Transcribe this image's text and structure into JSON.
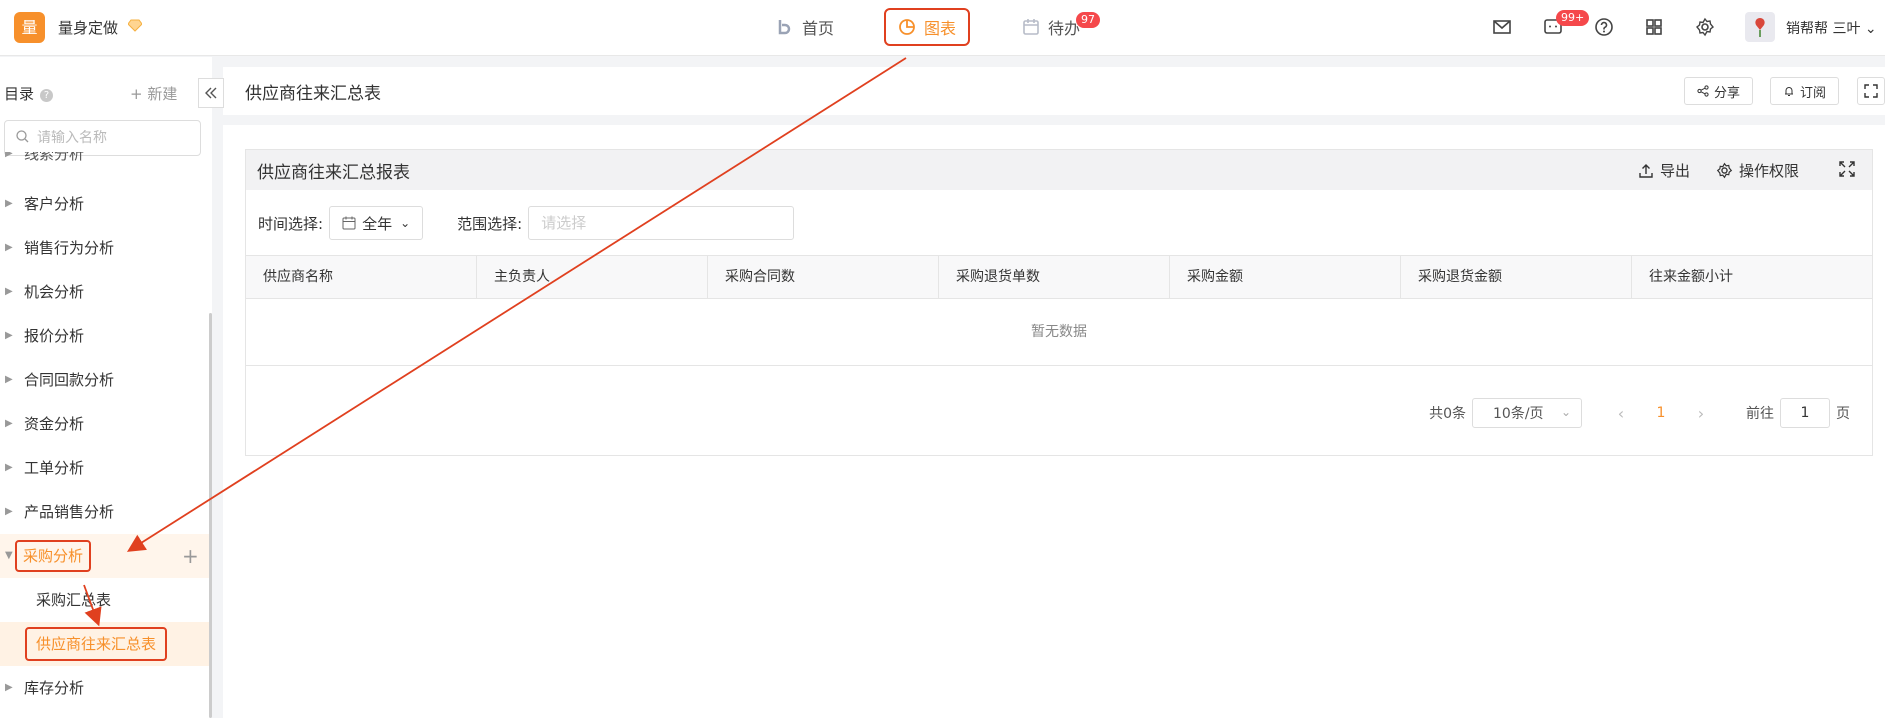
{
  "app": {
    "logo_char": "量",
    "name": "量身定做"
  },
  "nav": [
    {
      "label": "首页"
    },
    {
      "label": "图表"
    },
    {
      "label": "待办"
    }
  ],
  "badges": {
    "todo": "97",
    "messages": "99+"
  },
  "header_icons": [
    "mail-icon",
    "message-icon",
    "help-icon",
    "apps-grid-icon",
    "settings-icon"
  ],
  "user": {
    "name": "销帮帮 三叶"
  },
  "sidebar": {
    "title": "目录",
    "help": "?",
    "new_label": "+ 新建",
    "search_placeholder": "请输入名称",
    "items": [
      {
        "label": "线索分析"
      },
      {
        "label": "客户分析"
      },
      {
        "label": "销售行为分析"
      },
      {
        "label": "机会分析"
      },
      {
        "label": "报价分析"
      },
      {
        "label": "合同回款分析"
      },
      {
        "label": "资金分析"
      },
      {
        "label": "工单分析"
      },
      {
        "label": "产品销售分析"
      },
      {
        "label": "采购分析"
      },
      {
        "label": "库存分析"
      }
    ],
    "sub_items": [
      {
        "label": "采购汇总表"
      },
      {
        "label": "供应商往来汇总表"
      }
    ]
  },
  "page": {
    "title": "供应商往来汇总表",
    "share_label": "分享",
    "subscribe_label": "订阅"
  },
  "report": {
    "title": "供应商往来汇总报表",
    "export_label": "导出",
    "permission_label": "操作权限",
    "time_label": "时间选择:",
    "time_value": "全年",
    "range_label": "范围选择:",
    "range_placeholder": "请选择",
    "columns": [
      "供应商名称",
      "主负责人",
      "采购合同数",
      "采购退货单数",
      "采购金额",
      "采购退货金额",
      "往来金额小计"
    ],
    "empty_text": "暂无数据"
  },
  "pagination": {
    "total": "共0条",
    "page_size": "10条/页",
    "current_page": "1",
    "goto_label": "前往",
    "goto_value": "1",
    "page_unit": "页"
  },
  "colors": {
    "brand": "#f7902b",
    "annotation": "#e0401f",
    "badge": "#f5484b"
  }
}
